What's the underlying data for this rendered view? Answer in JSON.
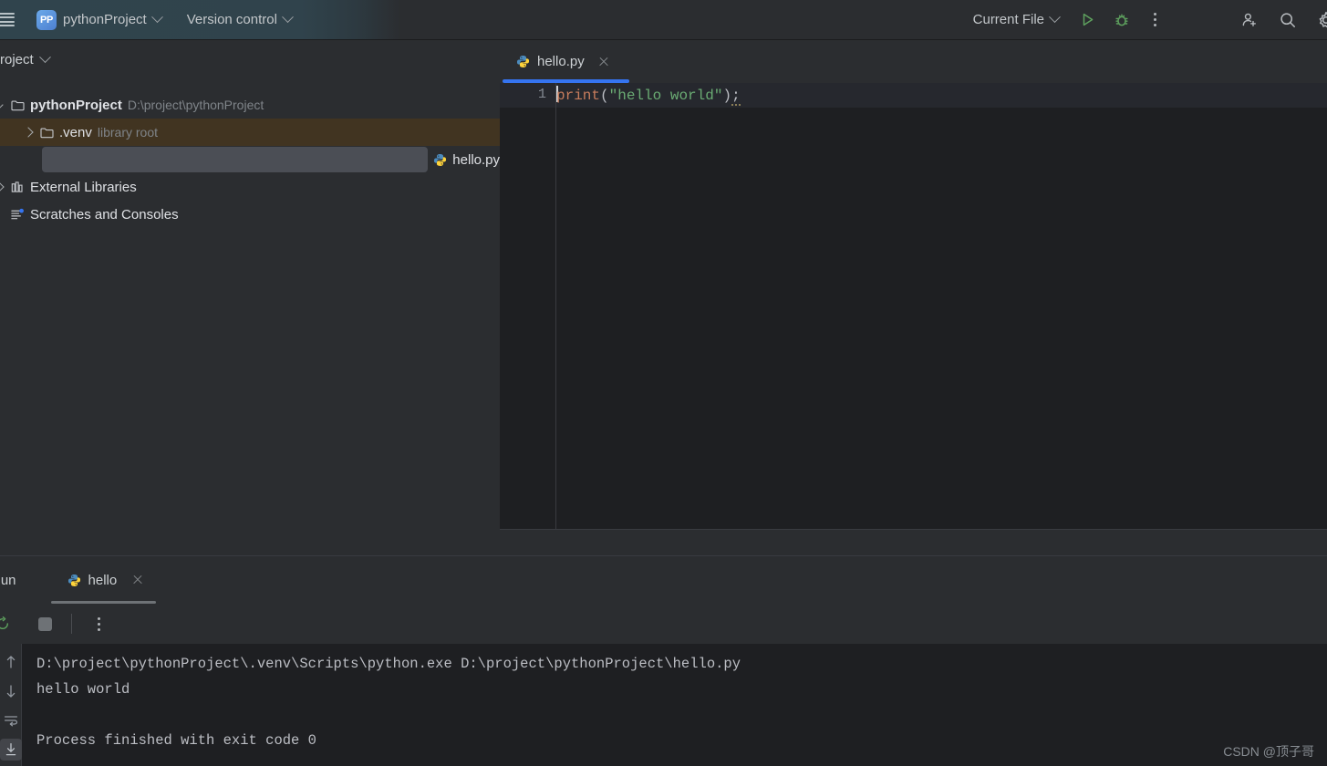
{
  "titlebar": {
    "menu_icon": "hamburger-icon",
    "project_badge": "PP",
    "project_name": "pythonProject",
    "vcs_label": "Version control",
    "run_config": "Current File",
    "run_icon": "run-icon",
    "debug_icon": "debug-icon",
    "more_icon": "more-options-icon",
    "share_icon": "add-user-icon",
    "search_icon": "search-icon",
    "settings_icon": "settings-gear-icon",
    "accent_blue": "#3574f0",
    "run_green": "#5ea15e"
  },
  "sidebar": {
    "title": "Project",
    "tree": [
      {
        "name": "pythonProject",
        "hint": "D:\\project\\pythonProject",
        "icon": "folder-icon",
        "arrow": "down",
        "level": 0,
        "bold": true,
        "state": "normal"
      },
      {
        "name": ".venv",
        "hint": "library root",
        "icon": "folder-icon",
        "arrow": "right",
        "level": 1,
        "bold": false,
        "state": "hover"
      },
      {
        "name": "hello.py",
        "hint": "",
        "icon": "python-file-icon",
        "arrow": "none",
        "level": 2,
        "bold": false,
        "state": "selected"
      },
      {
        "name": "External Libraries",
        "hint": "",
        "icon": "library-icon",
        "arrow": "right",
        "level": 0,
        "bold": false,
        "state": "normal"
      },
      {
        "name": "Scratches and Consoles",
        "hint": "",
        "icon": "scratches-icon",
        "arrow": "none",
        "level": 0,
        "bold": false,
        "state": "normal"
      }
    ]
  },
  "editor": {
    "tab_label": "hello.py",
    "tab_icon": "python-file-icon",
    "tab_close_icon": "close-icon",
    "line_number": "1",
    "code": {
      "fn": "print",
      "open_paren": "(",
      "string": "\"hello world\"",
      "close_paren": ")",
      "semicolon": ";"
    }
  },
  "run_panel": {
    "title": "Run",
    "tab_label": "hello",
    "tab_icon": "python-file-icon",
    "tab_close_icon": "close-icon",
    "toolbar": {
      "rerun_icon": "rerun-icon",
      "stop_icon": "stop-icon",
      "more_icon": "more-options-icon"
    },
    "side_tools": [
      {
        "icon": "scroll-up-icon",
        "active": false
      },
      {
        "icon": "scroll-down-icon",
        "active": false
      },
      {
        "icon": "soft-wrap-icon",
        "active": false
      },
      {
        "icon": "scroll-to-end-icon",
        "active": true
      }
    ],
    "console": {
      "command": "D:\\project\\pythonProject\\.venv\\Scripts\\python.exe D:\\project\\pythonProject\\hello.py",
      "output": "hello world",
      "blank": "",
      "exit_line": "Process finished with exit code 0"
    }
  },
  "watermark": "CSDN @顶子哥"
}
